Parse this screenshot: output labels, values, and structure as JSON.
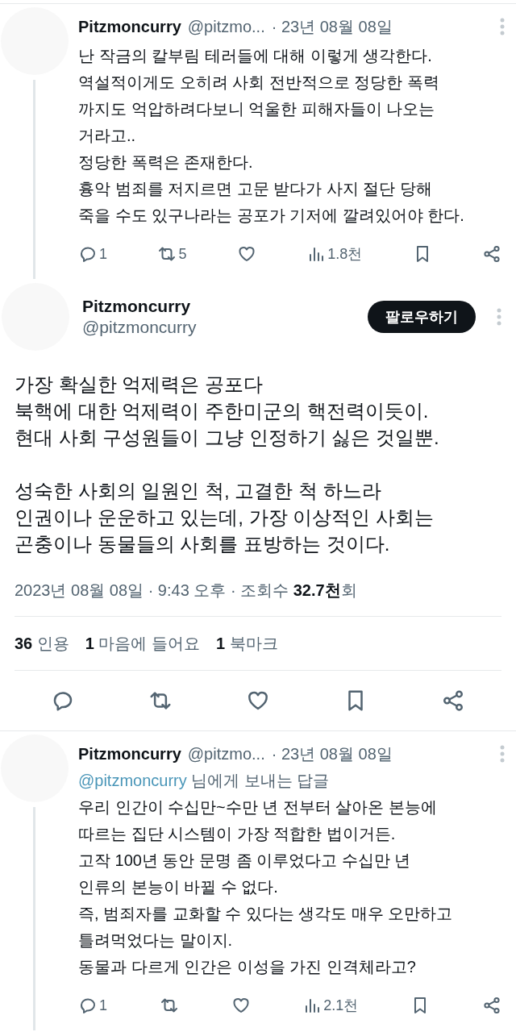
{
  "posts": [
    {
      "kind": "compact",
      "author": "Pitzmoncurry",
      "handle": "@pitzmo...",
      "date": "· 23년 08월 08일",
      "thread_line": true,
      "text": "난 작금의 칼부림 테러들에 대해 이렇게 생각한다.\n역설적이게도 오히려 사회 전반적으로 정당한 폭력\n까지도 억압하려다보니 억울한 피해자들이 나오는\n거라고..\n정당한 폭력은 존재한다.\n흉악 범죄를 저지르면 고문 받다가 사지 절단 당해\n죽을 수도 있구나라는 공포가 기저에 깔려있어야 한다.",
      "replies": "1",
      "reposts": "5",
      "views": "1.8천"
    },
    {
      "kind": "focal",
      "author": "Pitzmoncurry",
      "handle": "@pitzmoncurry",
      "follow_button": "팔로우하기",
      "paragraphs": [
        "가장 확실한 억제력은 공포다\n북핵에 대한 억제력이 주한미군의 핵전력이듯이.\n현대 사회 구성원들이 그냥 인정하기 싫은 것일뿐.",
        "성숙한 사회의 일원인 척, 고결한 척 하느라\n인권이나 운운하고 있는데, 가장 이상적인 사회는\n곤충이나 동물들의 사회를 표방하는 것이다."
      ],
      "timestamp": "2023년 08월 08일 · 9:43 오후 · 조회수 **32.7천**회",
      "stats": [
        {
          "count": "36",
          "label": "인용"
        },
        {
          "count": "1",
          "label": "마음에 들어요"
        },
        {
          "count": "1",
          "label": "북마크"
        }
      ]
    },
    {
      "kind": "compact",
      "author": "Pitzmoncurry",
      "handle": "@pitzmo...",
      "date": "· 23년 08월 08일",
      "thread_line": true,
      "reply_to": "@pitzmoncurry",
      "reply_to_suffix": "님에게 보내는 답글",
      "text": "우리 인간이 수십만~수만 년 전부터 살아온 본능에\n따르는 집단 시스템이 가장 적합한 법이거든.\n고작 100년 동안 문명 좀 이루었다고 수십만 년\n인류의 본능이 바뀔 수 없다.\n즉, 범죄자를 교화할 수 있다는 생각도 매우 오만하고\n틀려먹었다는 말이지.\n동물과 다르게 인간은 이성을 가진 인격체라고?",
      "replies": "1",
      "views": "2.1천"
    }
  ]
}
